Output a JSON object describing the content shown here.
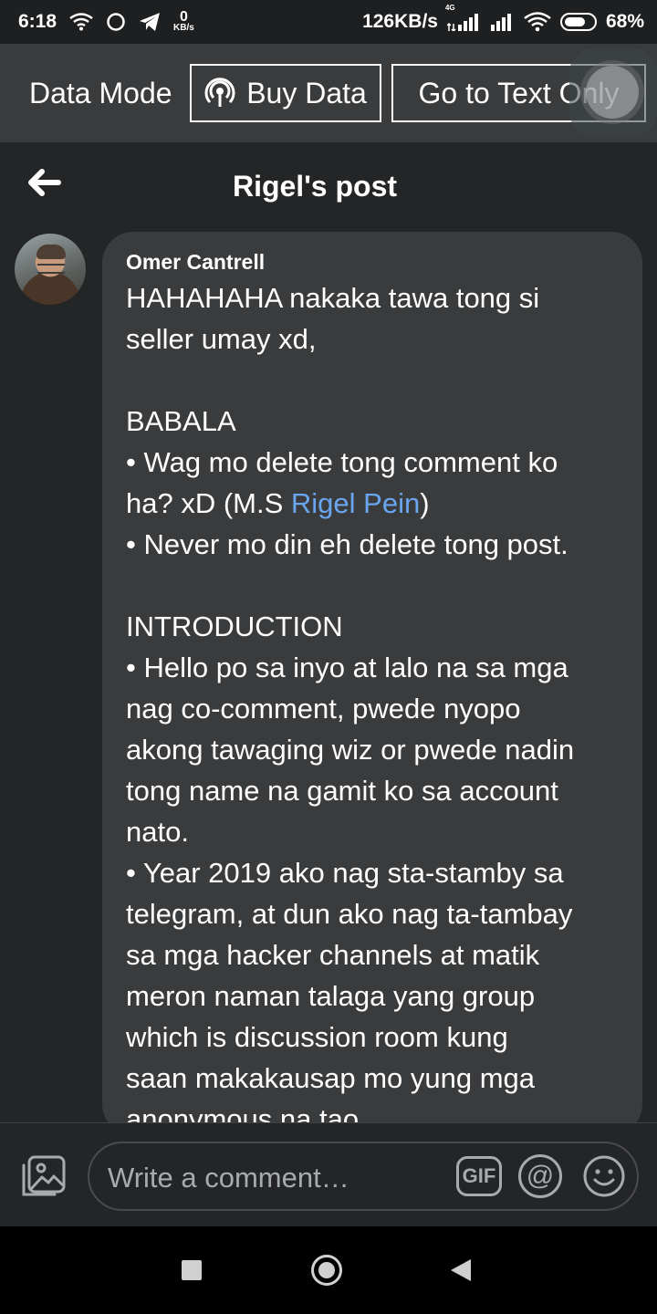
{
  "status_bar": {
    "time": "6:18",
    "speed_small_value": "0",
    "speed_small_unit": "KB/s",
    "network_speed": "126KB/s",
    "network_type": "4G",
    "battery": "68%"
  },
  "data_bar": {
    "label": "Data Mode",
    "buy_data": "Buy Data",
    "text_only": "Go to Text Only"
  },
  "header": {
    "title": "Rigel's post"
  },
  "comment": {
    "author": "Omer Cantrell",
    "lines": {
      "l1": "HAHAHAHA nakaka tawa tong si",
      "l2": "seller umay xd,",
      "l4": "BABALA",
      "l5": "• Wag mo delete tong comment ko",
      "l6a": "ha? xD (M.S ",
      "l6_mention": "Rigel Pein",
      "l6b": ")",
      "l7": "• Never mo din eh delete tong post.",
      "l9": "INTRODUCTION",
      "l10": "• Hello po sa inyo at lalo na sa mga",
      "l11": "nag co-comment, pwede nyopo",
      "l12": "akong tawaging wiz or pwede nadin",
      "l13": "tong name na gamit ko sa account",
      "l14": "nato.",
      "l15": "• Year 2019 ako nag sta-stamby sa",
      "l16": "telegram, at dun ako nag ta-tambay",
      "l17": "sa mga hacker channels at matik",
      "l18": "meron naman talaga yang group",
      "l19": "which is discussion room kung",
      "l20": "saan makakausap mo yung mga",
      "l21": "anonymous na tao"
    }
  },
  "composer": {
    "placeholder": "Write a comment…",
    "gif_label": "GIF",
    "at_label": "@"
  }
}
